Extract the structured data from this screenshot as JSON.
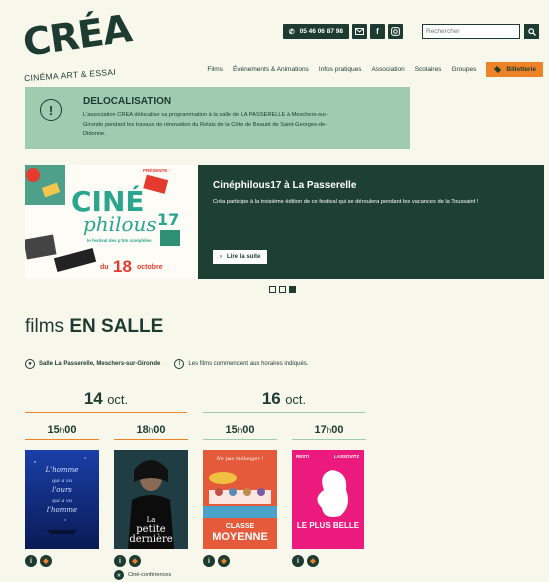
{
  "logo": {
    "title": "CRÉA",
    "subtitle": "CINÉMA ART & ESSAI"
  },
  "header": {
    "phone": "05 46 06 87 98",
    "search_placeholder": "Rechercher",
    "social": {
      "facebook": "f"
    }
  },
  "nav": {
    "items": [
      "Films",
      "Événements & Animations",
      "Infos pratiques",
      "Association",
      "Scolaires",
      "Groupes"
    ],
    "billetterie": "Billetterie"
  },
  "alert": {
    "title": "DELOCALISATION",
    "text": "L'association CREA délocalise sa programmation à la salle de LA PASSERELLE à Meschers-sur-Gironde pendant les travaux de rénovation du Relais de la Côte de Beauté de Saint-Georges-de-Didonne."
  },
  "carousel": {
    "image": {
      "presente": "PRÉSENTE :",
      "brand_top": "CINÉ",
      "brand_bottom": "philous",
      "brand_num": "17",
      "tagline": "le festival des p'tits cinéphiles",
      "date_prefix": "du",
      "date_day": "18",
      "date_month": "octobre"
    },
    "title": "Cinéphilous17 à La Passerelle",
    "text": "Créa participe à la troisième édition de ce festival qui se déroulera pendant les vacances de la Toussaint !",
    "button": "Lire la suite",
    "active_slide": 3,
    "slide_count": 3
  },
  "section": {
    "title_light": "films",
    "title_bold": "EN SALLE"
  },
  "info": {
    "location": "Salle La Passerelle, Meschers-sur-Gironde",
    "note": "Les films commencent aux horaires indiqués."
  },
  "days": [
    {
      "num": "14",
      "month": "oct."
    },
    {
      "num": "16",
      "month": "oct."
    }
  ],
  "screenings": [
    {
      "hour": "15",
      "min": "00",
      "poster_lines": [
        "L'homme",
        "qui a vu",
        "l'ours",
        "qui a vu",
        "l'homme"
      ]
    },
    {
      "hour": "18",
      "min": "00",
      "poster_lines": [
        "La",
        "petite",
        "dernière"
      ],
      "tag": "Ciné-conférences"
    },
    {
      "hour": "15",
      "min": "00",
      "poster_lines": [
        "Ne pas mélanger !",
        "CLASSE",
        "MOYENNE"
      ]
    },
    {
      "hour": "17",
      "min": "00",
      "poster_lines": [
        "LE PLUS BELLE",
        "RESTI",
        "LASSOVITZ"
      ]
    }
  ],
  "colors": {
    "dark_green": "#1d3b30",
    "mint": "#9fcbb1",
    "orange": "#ee8227",
    "background": "#f8f7ec"
  }
}
